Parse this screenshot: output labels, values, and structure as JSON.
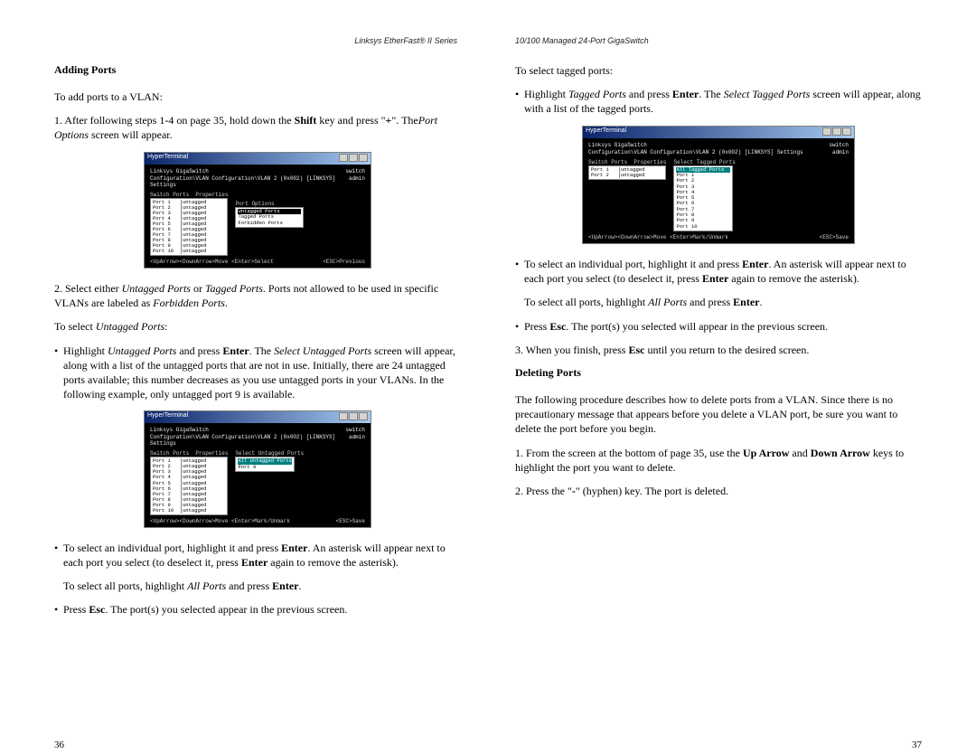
{
  "left": {
    "header": "Linksys EtherFast® II Series",
    "h_adding": "Adding Ports",
    "intro": "To add ports to a VLAN:",
    "step1_a": "1. After following steps 1-4 on page 35, hold down the ",
    "step1_shift": "Shift",
    "step1_b": " key and press \"",
    "step1_plus": "+",
    "step1_c": "\". The",
    "step1_po": "Port Options",
    "step1_d": " screen will appear.",
    "step2_a": "2. Select either ",
    "step2_up": "Untagged Ports",
    "step2_b": " or ",
    "step2_tp": "Tagged Ports",
    "step2_c": ". Ports not allowed to be used in specific VLANs are labeled as ",
    "step2_fp": "Forbidden Ports",
    "step2_d": ".",
    "sel_untagged_a": "To select ",
    "sel_untagged_i": "Untagged Ports",
    "sel_untagged_b": ":",
    "b1_a": "Highlight ",
    "b1_up": "Untagged Ports",
    "b1_b": " and press ",
    "b1_enter": "Enter",
    "b1_c": ". The ",
    "b1_sup": "Select Untagged Ports",
    "b1_d": " screen will appear, along with a list of the untagged ports that are not in use. Initially, there are 24 untagged ports available; this number decreases as you use untagged ports in your VLANs. In the following example, only untagged port 9 is available.",
    "b2_a": "To select an individual port, highlight it and press ",
    "b2_enter": "Enter",
    "b2_b": ". An asterisk will appear next to each port you select (to deselect it, press ",
    "b2_enter2": "Enter",
    "b2_c": " again to remove the asterisk).",
    "b3_a": "To select all ports, highlight ",
    "b3_ap": "All Ports",
    "b3_b": " and press ",
    "b3_enter": "Enter",
    "b3_c": ".",
    "b4_a": "Press ",
    "b4_esc": "Esc",
    "b4_b": ". The port(s) you selected appear in the previous screen.",
    "page": "36",
    "ss1": {
      "title": "HyperTerminal",
      "line1a": "Linksys GigaSwitch",
      "line1b": "switch",
      "line2a": "Configuration\\VLAN Configuration\\VLAN 2 (0x002) [LINKSYS] Settings",
      "line2b": "admin",
      "col_labs": [
        "Switch Ports",
        "Properties"
      ],
      "ports": [
        [
          "Port 1",
          "untagged"
        ],
        [
          "Port 2",
          "untagged"
        ],
        [
          "Port 3",
          "untagged"
        ],
        [
          "Port 4",
          "untagged"
        ],
        [
          "Port 5",
          "untagged"
        ],
        [
          "Port 6",
          "untagged"
        ],
        [
          "Port 7",
          "untagged"
        ],
        [
          "Port 8",
          "untagged"
        ],
        [
          "Port 9",
          "untagged"
        ],
        [
          "Port 10",
          "untagged"
        ]
      ],
      "opt_label": "Port Options",
      "opts": [
        "Untagged Ports",
        "Tagged Ports",
        "Forbidden Ports"
      ],
      "foot_l": "<UpArrow><DownArrow>Move  <Enter>Select",
      "foot_r": "<ESC>Previous"
    },
    "ss2": {
      "title": "HyperTerminal",
      "line1a": "Linksys GigaSwitch",
      "line1b": "switch",
      "line2a": "Configuration\\VLAN Configuration\\VLAN 2 (0x002) [LINKSYS] Settings",
      "line2b": "admin",
      "col_labs": [
        "Switch Ports",
        "Properties",
        "Select Untagged Ports"
      ],
      "ports": [
        [
          "Port 1",
          "untagged"
        ],
        [
          "Port 2",
          "untagged"
        ],
        [
          "Port 3",
          "untagged"
        ],
        [
          "Port 4",
          "untagged"
        ],
        [
          "Port 5",
          "untagged"
        ],
        [
          "Port 6",
          "untagged"
        ],
        [
          "Port 7",
          "untagged"
        ],
        [
          "Port 8",
          "untagged"
        ],
        [
          "Port 9",
          "untagged"
        ],
        [
          "Port 10",
          "untagged"
        ]
      ],
      "sel": [
        "All Untagged Ports",
        "Port  9"
      ],
      "foot_l": "<UpArrow><DownArrow>Move  <Enter>Mark/Unmark",
      "foot_r": "<ESC>Save"
    }
  },
  "right": {
    "header": "10/100 Managed 24-Port GigaSwitch",
    "sel_tagged": "To select tagged ports:",
    "b1_a": "Highlight ",
    "b1_tp": "Tagged Ports",
    "b1_b": " and press ",
    "b1_enter": "Enter",
    "b1_c": ". The ",
    "b1_stp": "Select Tagged Ports",
    "b1_d": " screen will appear, along with a list of the tagged ports.",
    "b2_a": "To select an individual port, highlight it and press ",
    "b2_enter": "Enter",
    "b2_b": ". An asterisk will appear next to each port you select (to deselect it, press ",
    "b2_enter2": "Enter",
    "b2_c": " again to remove the asterisk).",
    "b3_a": "To select all ports, highlight ",
    "b3_ap": "All Ports",
    "b3_b": " and press ",
    "b3_enter": "Enter",
    "b3_c": ".",
    "b4_a": "Press ",
    "b4_esc": "Esc",
    "b4_b": ". The port(s) you selected will appear in the previous screen.",
    "step3_a": "3. When you finish, press ",
    "step3_esc": "Esc",
    "step3_b": " until you return to the desired screen.",
    "h_deleting": "Deleting Ports",
    "del_intro": "The following procedure describes how to delete ports from a VLAN. Since there is no precautionary message that appears before you delete a VLAN port, be sure you want to delete the port before you begin.",
    "d1_a": "1. From the screen at the bottom of page 35, use the ",
    "d1_up": "Up Arrow",
    "d1_b": " and ",
    "d1_dn": "Down Arrow",
    "d1_c": " keys to highlight the port you want to delete.",
    "d2_a": "2. Press the \"",
    "d2_hy": "-",
    "d2_b": "\" (hyphen) key. The port is deleted.",
    "page": "37",
    "ss3": {
      "title": "HyperTerminal",
      "line1a": "Linksys GigaSwitch",
      "line1b": "switch",
      "line2a": "Configuration\\VLAN Configuration\\VLAN 2 (0x002) [LINKSYS] Settings",
      "line2b": "admin",
      "col_labs": [
        "Switch Ports",
        "Properties",
        "Select Tagged Ports"
      ],
      "ports": [
        [
          "Port 1",
          "untagged"
        ],
        [
          "Port 2",
          "untagged"
        ]
      ],
      "sel": [
        "All Tagged Ports",
        "Port  1",
        "Port  2",
        "Port  3",
        "Port  4",
        "Port  5",
        "Port  6",
        "Port  7",
        "Port  8",
        "Port  9",
        "Port 10"
      ],
      "foot_l": "<UpArrow><DownArrow>Move  <Enter>Mark/Unmark",
      "foot_r": "<ESC>Save"
    }
  }
}
